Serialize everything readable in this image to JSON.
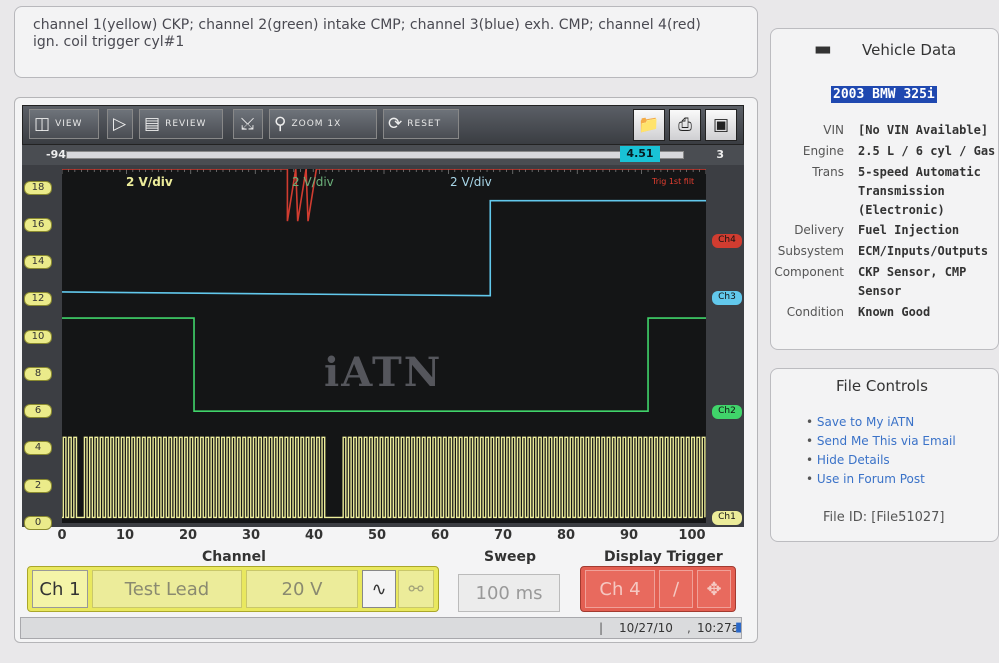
{
  "description": {
    "line1": "channel 1(yellow) CKP; channel 2(green) intake CMP; channel 3(blue) exh. CMP; channel 4(red)",
    "line2": "ign. coil trigger cyl#1"
  },
  "toolbar": {
    "view_label": "VIEW",
    "review_label": "REVIEW",
    "zoom_label": "ZOOM 1x",
    "reset_label": "RESET"
  },
  "slider": {
    "left": "-94",
    "position": "4.51",
    "right": "3"
  },
  "display": {
    "ch1_vdiv": "2 V/div",
    "ch2_vdiv": "2 V/div",
    "ch3_vdiv": "2 V/div",
    "ch4_trigger_text": "Trig 1st filt",
    "watermark": "iATN",
    "ch_tags": [
      "Ch4",
      "Ch3",
      "Ch2",
      "Ch1"
    ]
  },
  "colors": {
    "ch1": "#ecec9a",
    "ch2": "#40d46a",
    "ch3": "#62c8ec",
    "ch4": "#d03c30"
  },
  "chart_data": {
    "type": "line",
    "yticks": [
      18,
      16,
      14,
      12,
      10,
      8,
      6,
      4,
      2,
      0
    ],
    "xticks": [
      0,
      10,
      20,
      30,
      40,
      50,
      60,
      70,
      80,
      90,
      100
    ],
    "xlim": [
      0,
      100
    ],
    "ylim": [
      0,
      19
    ],
    "series": [
      {
        "name": "Ch1",
        "values": [
          [
            0,
            4.6
          ],
          [
            100,
            4.6
          ]
        ]
      },
      {
        "name": "Ch2",
        "values": [
          [
            0,
            11
          ],
          [
            20.5,
            11
          ],
          [
            20.5,
            6
          ],
          [
            91,
            6
          ],
          [
            91,
            11
          ],
          [
            100,
            11
          ]
        ]
      },
      {
        "name": "Ch3",
        "values": [
          [
            0,
            12.4
          ],
          [
            66.5,
            12.2
          ],
          [
            66.5,
            17.3
          ],
          [
            100,
            17.3
          ]
        ]
      },
      {
        "name": "Ch4",
        "values": [
          [
            0,
            19
          ],
          [
            35,
            19
          ],
          [
            35,
            16.2
          ],
          [
            36.3,
            19
          ],
          [
            36.6,
            16.2
          ],
          [
            37.9,
            19
          ],
          [
            38.2,
            16.2
          ],
          [
            39.5,
            19
          ],
          [
            40,
            19
          ],
          [
            100,
            19
          ]
        ]
      }
    ]
  },
  "controls": {
    "channel_label": "Channel",
    "sweep_label": "Sweep",
    "trigger_label": "Display Trigger",
    "channel_value": "Ch 1",
    "lead_value": "Test Lead",
    "volt_value": "20 V",
    "sweep_value": "100 ms",
    "trigger_value": "Ch 4"
  },
  "status": {
    "date": "10/27/10",
    "time": "10:27a"
  },
  "vehicle": {
    "title": "Vehicle Data",
    "name": "2003 BMW 325i",
    "fields": [
      {
        "key": "VIN",
        "value": "[No VIN Available]"
      },
      {
        "key": "Engine",
        "value": "2.5 L / 6 cyl / Gas"
      },
      {
        "key": "Trans",
        "value": "5-speed Automatic Transmission (Electronic)"
      },
      {
        "key": "Delivery",
        "value": "Fuel Injection"
      },
      {
        "key": "Subsystem",
        "value": "ECM/Inputs/Outputs"
      },
      {
        "key": "Component",
        "value": "CKP Sensor, CMP Sensor"
      },
      {
        "key": "Condition",
        "value": "Known Good"
      }
    ]
  },
  "file_controls": {
    "title": "File Controls",
    "links": [
      "Save to My iATN",
      "Send Me This via Email",
      "Hide Details",
      "Use in Forum Post"
    ],
    "file_id": "File ID: [File51027]"
  }
}
